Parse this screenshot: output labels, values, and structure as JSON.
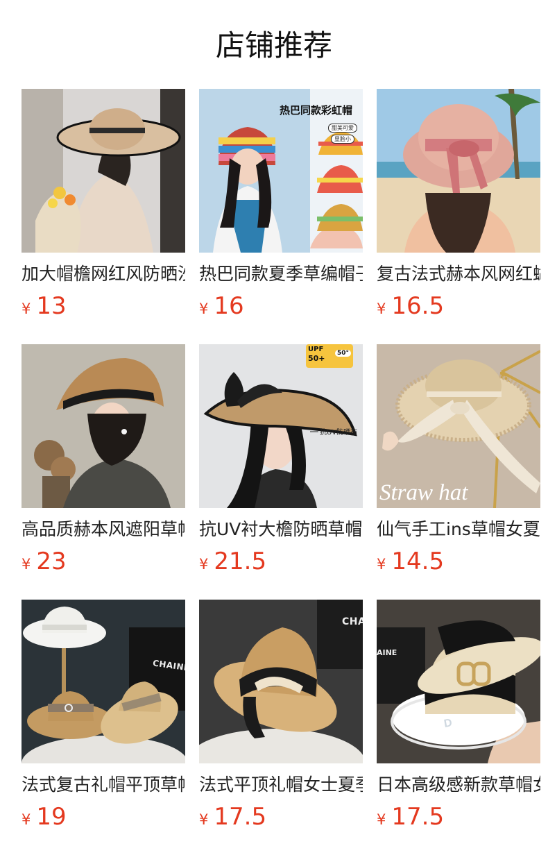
{
  "header": {
    "title": "店铺推荐"
  },
  "currency_symbol": "¥",
  "products": [
    {
      "name": "加大帽檐网红风防晒沙滩草帽",
      "price": "13",
      "image": "woman-wide-brim-straw-hat"
    },
    {
      "name": "热巴同款夏季草编帽子女",
      "price": "16",
      "image": "rainbow-crochet-bucket-hat",
      "overlay": {
        "headline": "热巴同款彩虹帽",
        "tags": [
          "甜美可爱",
          "显脸小"
        ]
      }
    },
    {
      "name": "复古法式赫本风网红蝴蝶结草帽",
      "price": "16.5",
      "image": "pink-bow-straw-hat-beach"
    },
    {
      "name": "高品质赫本风遮阳草帽女",
      "price": "23",
      "image": "woman-black-ribbon-hat"
    },
    {
      "name": "抗UV衬大檐防晒草帽空顶帽",
      "price": "21.5",
      "image": "uv-visor-straw-hat",
      "overlay": {
        "badge_left": "UPF",
        "badge_left_value": "50+",
        "badge_right": "50°",
        "callout": "抗UV防晒布"
      }
    },
    {
      "name": "仙气手工ins草帽女夏季",
      "price": "14.5",
      "image": "frayed-straw-hat-bow",
      "overlay": {
        "caption": "Straw hat"
      }
    },
    {
      "name": "法式复古礼帽平顶草帽",
      "price": "19",
      "image": "flat-top-boater-hats",
      "overlay": {
        "bag_text": "CHAINE"
      }
    },
    {
      "name": "法式平顶礼帽女士夏季草帽",
      "price": "17.5",
      "image": "boater-black-ribbon-hat",
      "overlay": {
        "bag_text": "CHA"
      }
    },
    {
      "name": "日本高级感新款草帽女",
      "price": "17.5",
      "image": "two-tone-boater-hat-hand",
      "overlay": {
        "bag_text": "AINE"
      }
    }
  ]
}
